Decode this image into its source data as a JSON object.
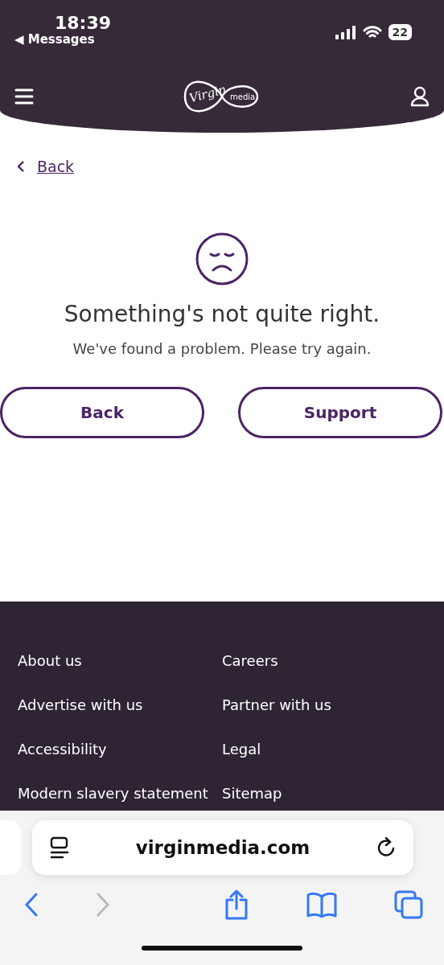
{
  "status_bar": {
    "time": "18:39",
    "back_app": "◀ Messages",
    "battery": "22"
  },
  "header": {
    "logo_script": "Virgin",
    "logo_word": "media"
  },
  "back_link": {
    "label": "Back"
  },
  "error": {
    "title": "Something's not quite right.",
    "message": "We've found a problem. Please try again."
  },
  "buttons": [
    {
      "label": "Back"
    },
    {
      "label": "Support"
    }
  ],
  "footer_links": [
    {
      "label": "About us"
    },
    {
      "label": "Careers"
    },
    {
      "label": "Advertise with us"
    },
    {
      "label": "Partner with us"
    },
    {
      "label": "Accessibility"
    },
    {
      "label": "Legal"
    },
    {
      "label": "Modern slavery statement"
    },
    {
      "label": "Sitemap"
    }
  ],
  "browser": {
    "url": "virginmedia.com"
  }
}
